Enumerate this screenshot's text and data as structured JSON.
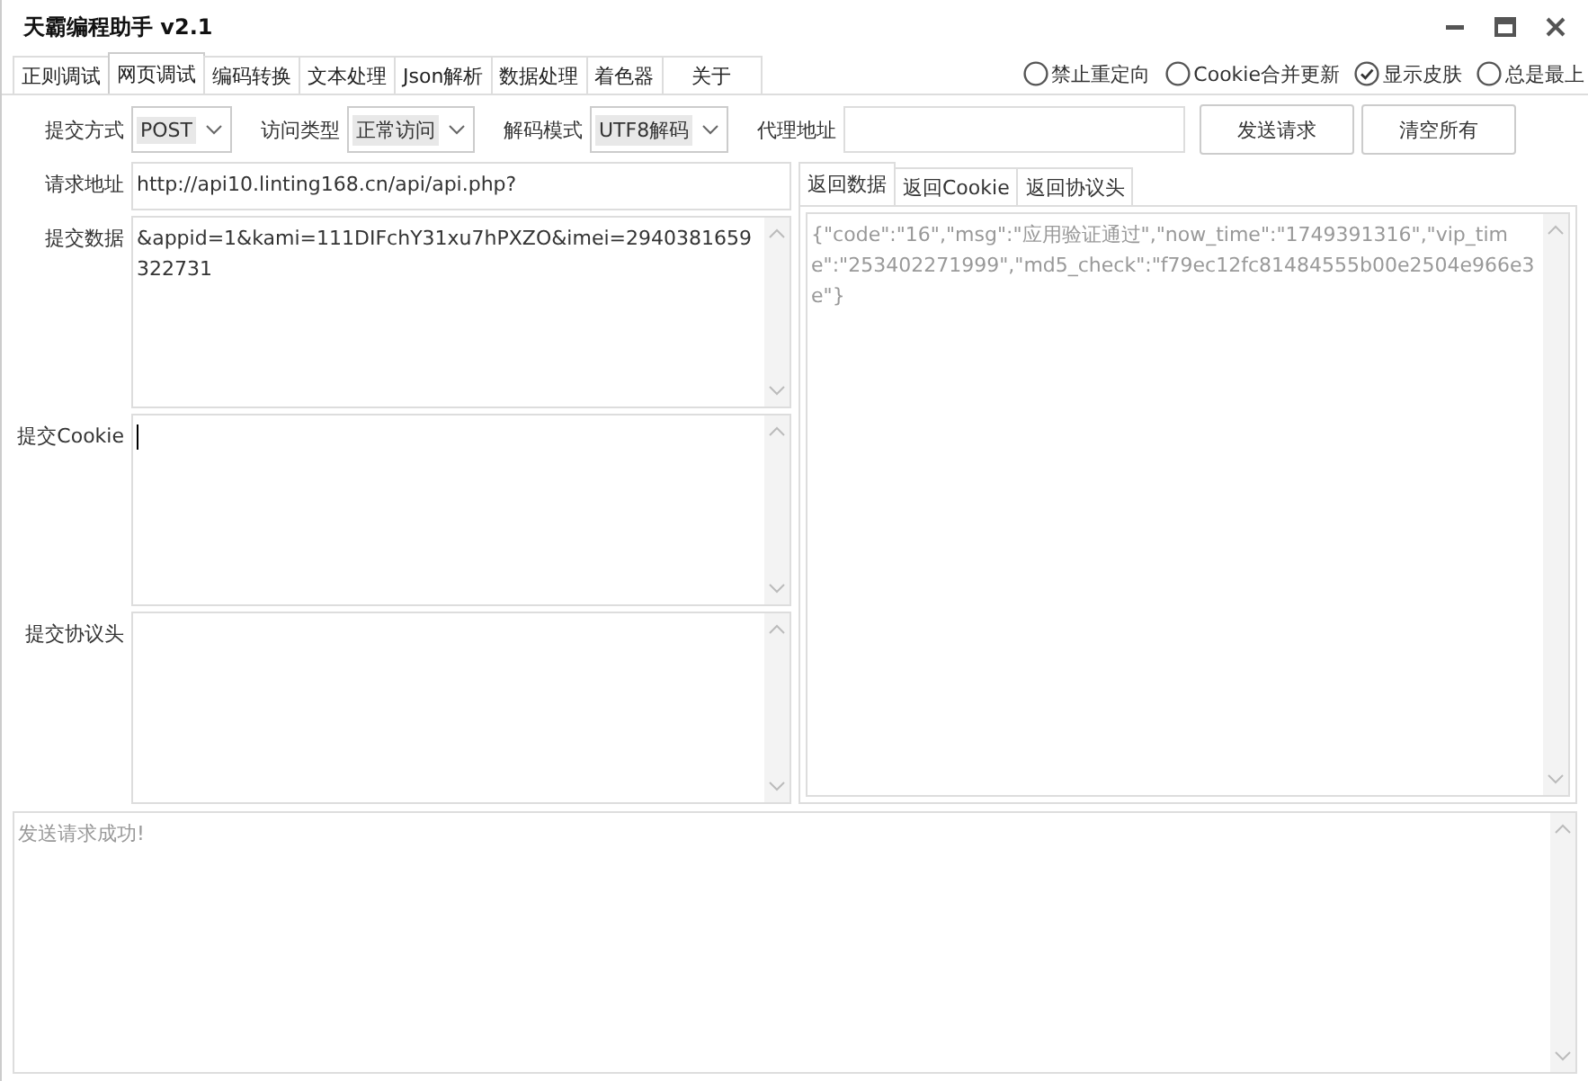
{
  "window": {
    "title": "天霸编程助手 v2.1"
  },
  "tabs": [
    {
      "label": "正则调试",
      "selected": false
    },
    {
      "label": "网页调试",
      "selected": true
    },
    {
      "label": "编码转换",
      "selected": false
    },
    {
      "label": "文本处理",
      "selected": false
    },
    {
      "label": "Json解析",
      "selected": false
    },
    {
      "label": "数据处理",
      "selected": false
    },
    {
      "label": "着色器",
      "selected": false
    },
    {
      "label": "关于",
      "selected": false
    }
  ],
  "options": [
    {
      "label": "禁止重定向",
      "checked": false
    },
    {
      "label": "Cookie合并更新",
      "checked": false
    },
    {
      "label": "显示皮肤",
      "checked": true
    },
    {
      "label": "总是最上",
      "checked": false
    }
  ],
  "toolbar": {
    "dropdowns": [
      {
        "label": "提交方式",
        "value": "POST"
      },
      {
        "label": "访问类型",
        "value": "正常访问"
      },
      {
        "label": "解码模式",
        "value": "UTF8解码"
      }
    ],
    "proxy": {
      "label": "代理地址"
    },
    "buttons": [
      "发送请求",
      "清空所有"
    ]
  },
  "request": {
    "url_label": "请求地址",
    "url": "http://api10.linting168.cn/api/api.php?",
    "fields": [
      {
        "label": "提交数据",
        "value": "&appid=1&kami=111DIFchY31xu7hPXZO&imei=2940381659322731",
        "caret": false
      },
      {
        "label": "提交Cookie",
        "caret": true
      },
      {
        "label": "提交协议头",
        "caret": false
      }
    ]
  },
  "response": {
    "tabs": [
      {
        "label": "返回数据",
        "selected": true
      },
      {
        "label": "返回Cookie",
        "selected": false
      },
      {
        "label": "返回协议头",
        "selected": false
      }
    ],
    "body": "{\"code\":\"16\",\"msg\":\"应用验证通过\",\"now_time\":\"1749391316\",\"vip_time\":\"253402271999\",\"md5_check\":\"f79ec12fc81484555b00e2504e966e3e\"}"
  },
  "log": "发送请求成功!"
}
